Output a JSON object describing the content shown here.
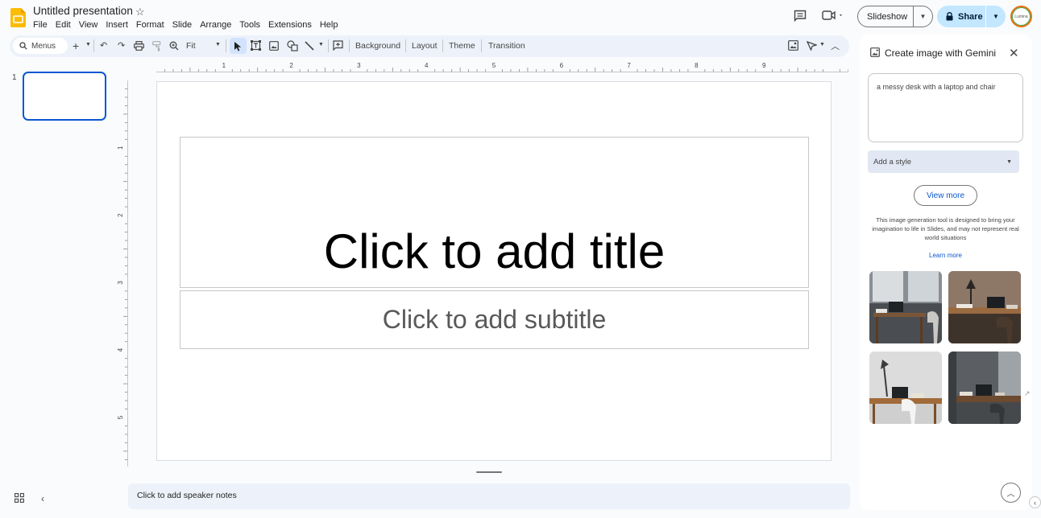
{
  "app": {
    "doc_title": "Untitled presentation",
    "menu": [
      "File",
      "Edit",
      "View",
      "Insert",
      "Format",
      "Slide",
      "Arrange",
      "Tools",
      "Extensions",
      "Help"
    ],
    "slideshow_label": "Slideshow",
    "share_label": "Share",
    "avatar_text": "Lumina"
  },
  "toolbar": {
    "search_label": "Menus",
    "zoom_label": "Fit",
    "background_label": "Background",
    "layout_label": "Layout",
    "theme_label": "Theme",
    "transition_label": "Transition"
  },
  "filmstrip": {
    "slide_number": "1"
  },
  "ruler": {
    "h_labels": [
      "1",
      "2",
      "3",
      "4",
      "5",
      "6",
      "7",
      "8",
      "9"
    ],
    "v_labels": [
      "1",
      "2",
      "3",
      "4",
      "5"
    ]
  },
  "slide": {
    "title_placeholder": "Click to add title",
    "subtitle_placeholder": "Click to add subtitle"
  },
  "notes": {
    "placeholder": "Click to add speaker notes"
  },
  "panel": {
    "title": "Create image with Gemini",
    "prompt_text": "a messy desk with a laptop and chair",
    "style_placeholder": "Add a style",
    "view_more_label": "View more",
    "disclaimer": "This image generation tool is designed to bring your imagination to life in Slides, and may not represent real world situations",
    "learn_more_label": "Learn more",
    "images": [
      {
        "name": "generated-image-1"
      },
      {
        "name": "generated-image-2"
      },
      {
        "name": "generated-image-3"
      },
      {
        "name": "generated-image-4"
      }
    ]
  },
  "colors": {
    "accent": "#0b57d0",
    "share_bg": "#c2e7ff",
    "toolbar_bg": "#edf2fa",
    "logo_yellow": "#fbbc04"
  }
}
